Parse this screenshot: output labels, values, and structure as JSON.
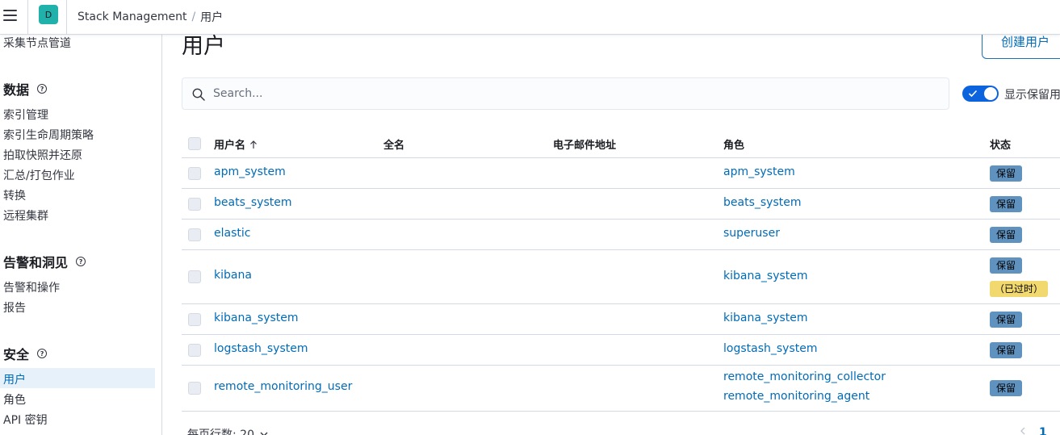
{
  "header": {
    "space_initial": "D",
    "breadcrumbs": [
      "Stack Management",
      "用户"
    ]
  },
  "sidebar": {
    "top_item": "采集节点管道",
    "sections": [
      {
        "title": "数据",
        "items": [
          "索引管理",
          "索引生命周期策略",
          "拍取快照并还原",
          "汇总/打包作业",
          "转换",
          "远程集群"
        ]
      },
      {
        "title": "告警和洞见",
        "items": [
          "告警和操作",
          "报告"
        ]
      },
      {
        "title": "安全",
        "items": [
          "用户",
          "角色",
          "API 密钥"
        ]
      }
    ],
    "active_item": "用户"
  },
  "page": {
    "title": "用户",
    "create_button": "创建用户",
    "search_placeholder": "Search...",
    "toggle_label": "显示保留用",
    "toggle_on": true
  },
  "table": {
    "columns": [
      "用户名",
      "全名",
      "电子邮件地址",
      "角色",
      "状态"
    ],
    "sort_icon": "arrow-up-icon",
    "rows": [
      {
        "username": "apm_system",
        "roles": [
          "apm_system"
        ],
        "badges": [
          "保留"
        ]
      },
      {
        "username": "beats_system",
        "roles": [
          "beats_system"
        ],
        "badges": [
          "保留"
        ]
      },
      {
        "username": "elastic",
        "roles": [
          "superuser"
        ],
        "badges": [
          "保留"
        ]
      },
      {
        "username": "kibana",
        "roles": [
          "kibana_system"
        ],
        "badges": [
          "保留",
          "（已过时）"
        ]
      },
      {
        "username": "kibana_system",
        "roles": [
          "kibana_system"
        ],
        "badges": [
          "保留"
        ]
      },
      {
        "username": "logstash_system",
        "roles": [
          "logstash_system"
        ],
        "badges": [
          "保留"
        ]
      },
      {
        "username": "remote_monitoring_user",
        "roles": [
          "remote_monitoring_collector",
          "remote_monitoring_agent"
        ],
        "badges": [
          "保留"
        ]
      }
    ]
  },
  "footer": {
    "rows_per_page": "每页行数: 20",
    "current_page": "1"
  },
  "colors": {
    "link": "#006bb8",
    "reserved_badge": "#6092c0",
    "deprecated_badge": "#f1d86f",
    "toggle": "#0b64dd",
    "space_avatar": "#20b2aa"
  }
}
